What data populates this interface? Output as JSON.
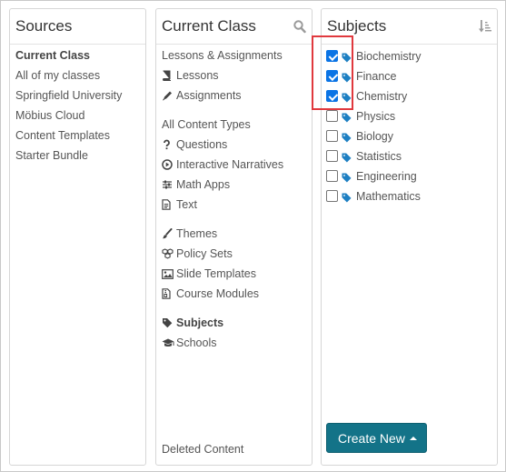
{
  "sources": {
    "title": "Sources",
    "items": [
      "Current Class",
      "All of my classes",
      "Springfield University",
      "Möbius Cloud",
      "Content Templates",
      "Starter Bundle"
    ]
  },
  "current_class": {
    "title": "Current Class",
    "search_icon": "search-icon",
    "lessons_assignments": "Lessons & Assignments",
    "lessons": "Lessons",
    "assignments": "Assignments",
    "all_content_types": "All Content Types",
    "questions": "Questions",
    "interactive_narratives": "Interactive Narratives",
    "math_apps": "Math Apps",
    "text": "Text",
    "themes": "Themes",
    "policy_sets": "Policy Sets",
    "slide_templates": "Slide Templates",
    "course_modules": "Course Modules",
    "subjects": "Subjects",
    "schools": "Schools",
    "deleted_content": "Deleted Content"
  },
  "subjects": {
    "title": "Subjects",
    "sort_icon": "sort-icon",
    "items": [
      {
        "label": "Biochemistry",
        "checked": true
      },
      {
        "label": "Finance",
        "checked": true
      },
      {
        "label": "Chemistry",
        "checked": true
      },
      {
        "label": "Physics",
        "checked": false
      },
      {
        "label": "Biology",
        "checked": false
      },
      {
        "label": "Statistics",
        "checked": false
      },
      {
        "label": "Engineering",
        "checked": false
      },
      {
        "label": "Mathematics",
        "checked": false
      }
    ],
    "create_new_label": "Create New"
  },
  "colors": {
    "accent_button": "#137388",
    "checkbox": "#0b74e5",
    "tag_icon": "#1d7fc2",
    "highlight": "#e0393e"
  }
}
